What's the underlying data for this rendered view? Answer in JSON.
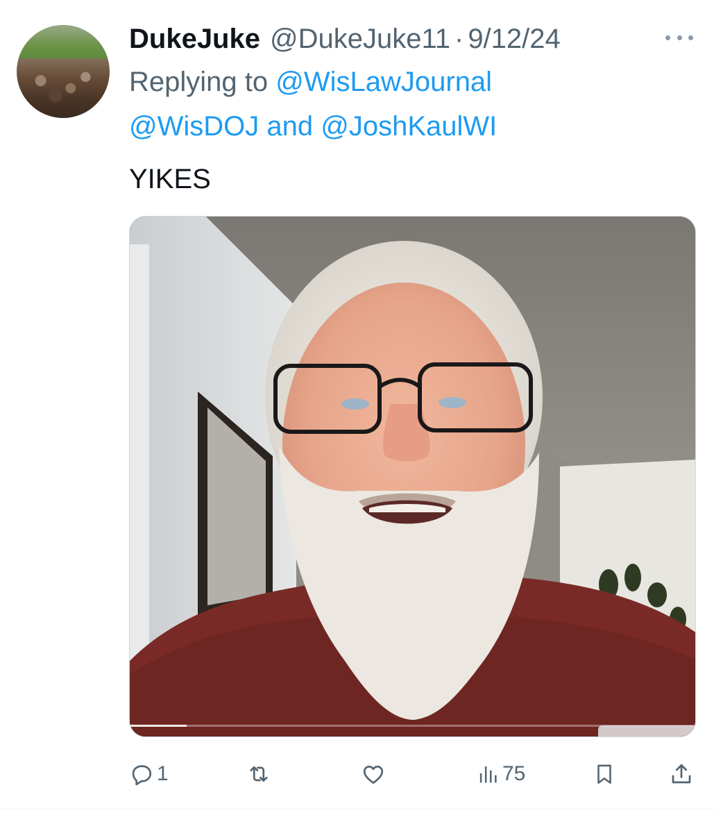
{
  "tweet": {
    "display_name": "DukeJuke",
    "handle": "@DukeJuke11",
    "separator": "·",
    "date": "9/12/24",
    "replying_prefix": "Replying to",
    "replying_mention_1": "@WisLawJournal",
    "replying_mention_2": "@WisDOJ",
    "replying_and": "and",
    "replying_mention_3": "@JoshKaulWI",
    "text": "YIKES",
    "video_progress": 0.1
  },
  "actions": {
    "reply_count": "1",
    "views_count": "75"
  },
  "colors": {
    "text": "#0f1419",
    "secondary": "#536471",
    "link": "#1d9bf0",
    "divider": "#eff3f4"
  },
  "icons": {
    "more": "more-dots-icon",
    "reply": "reply-icon",
    "retweet": "retweet-icon",
    "like": "heart-icon",
    "views": "views-bar-chart-icon",
    "bookmark": "bookmark-icon",
    "share": "share-icon"
  }
}
